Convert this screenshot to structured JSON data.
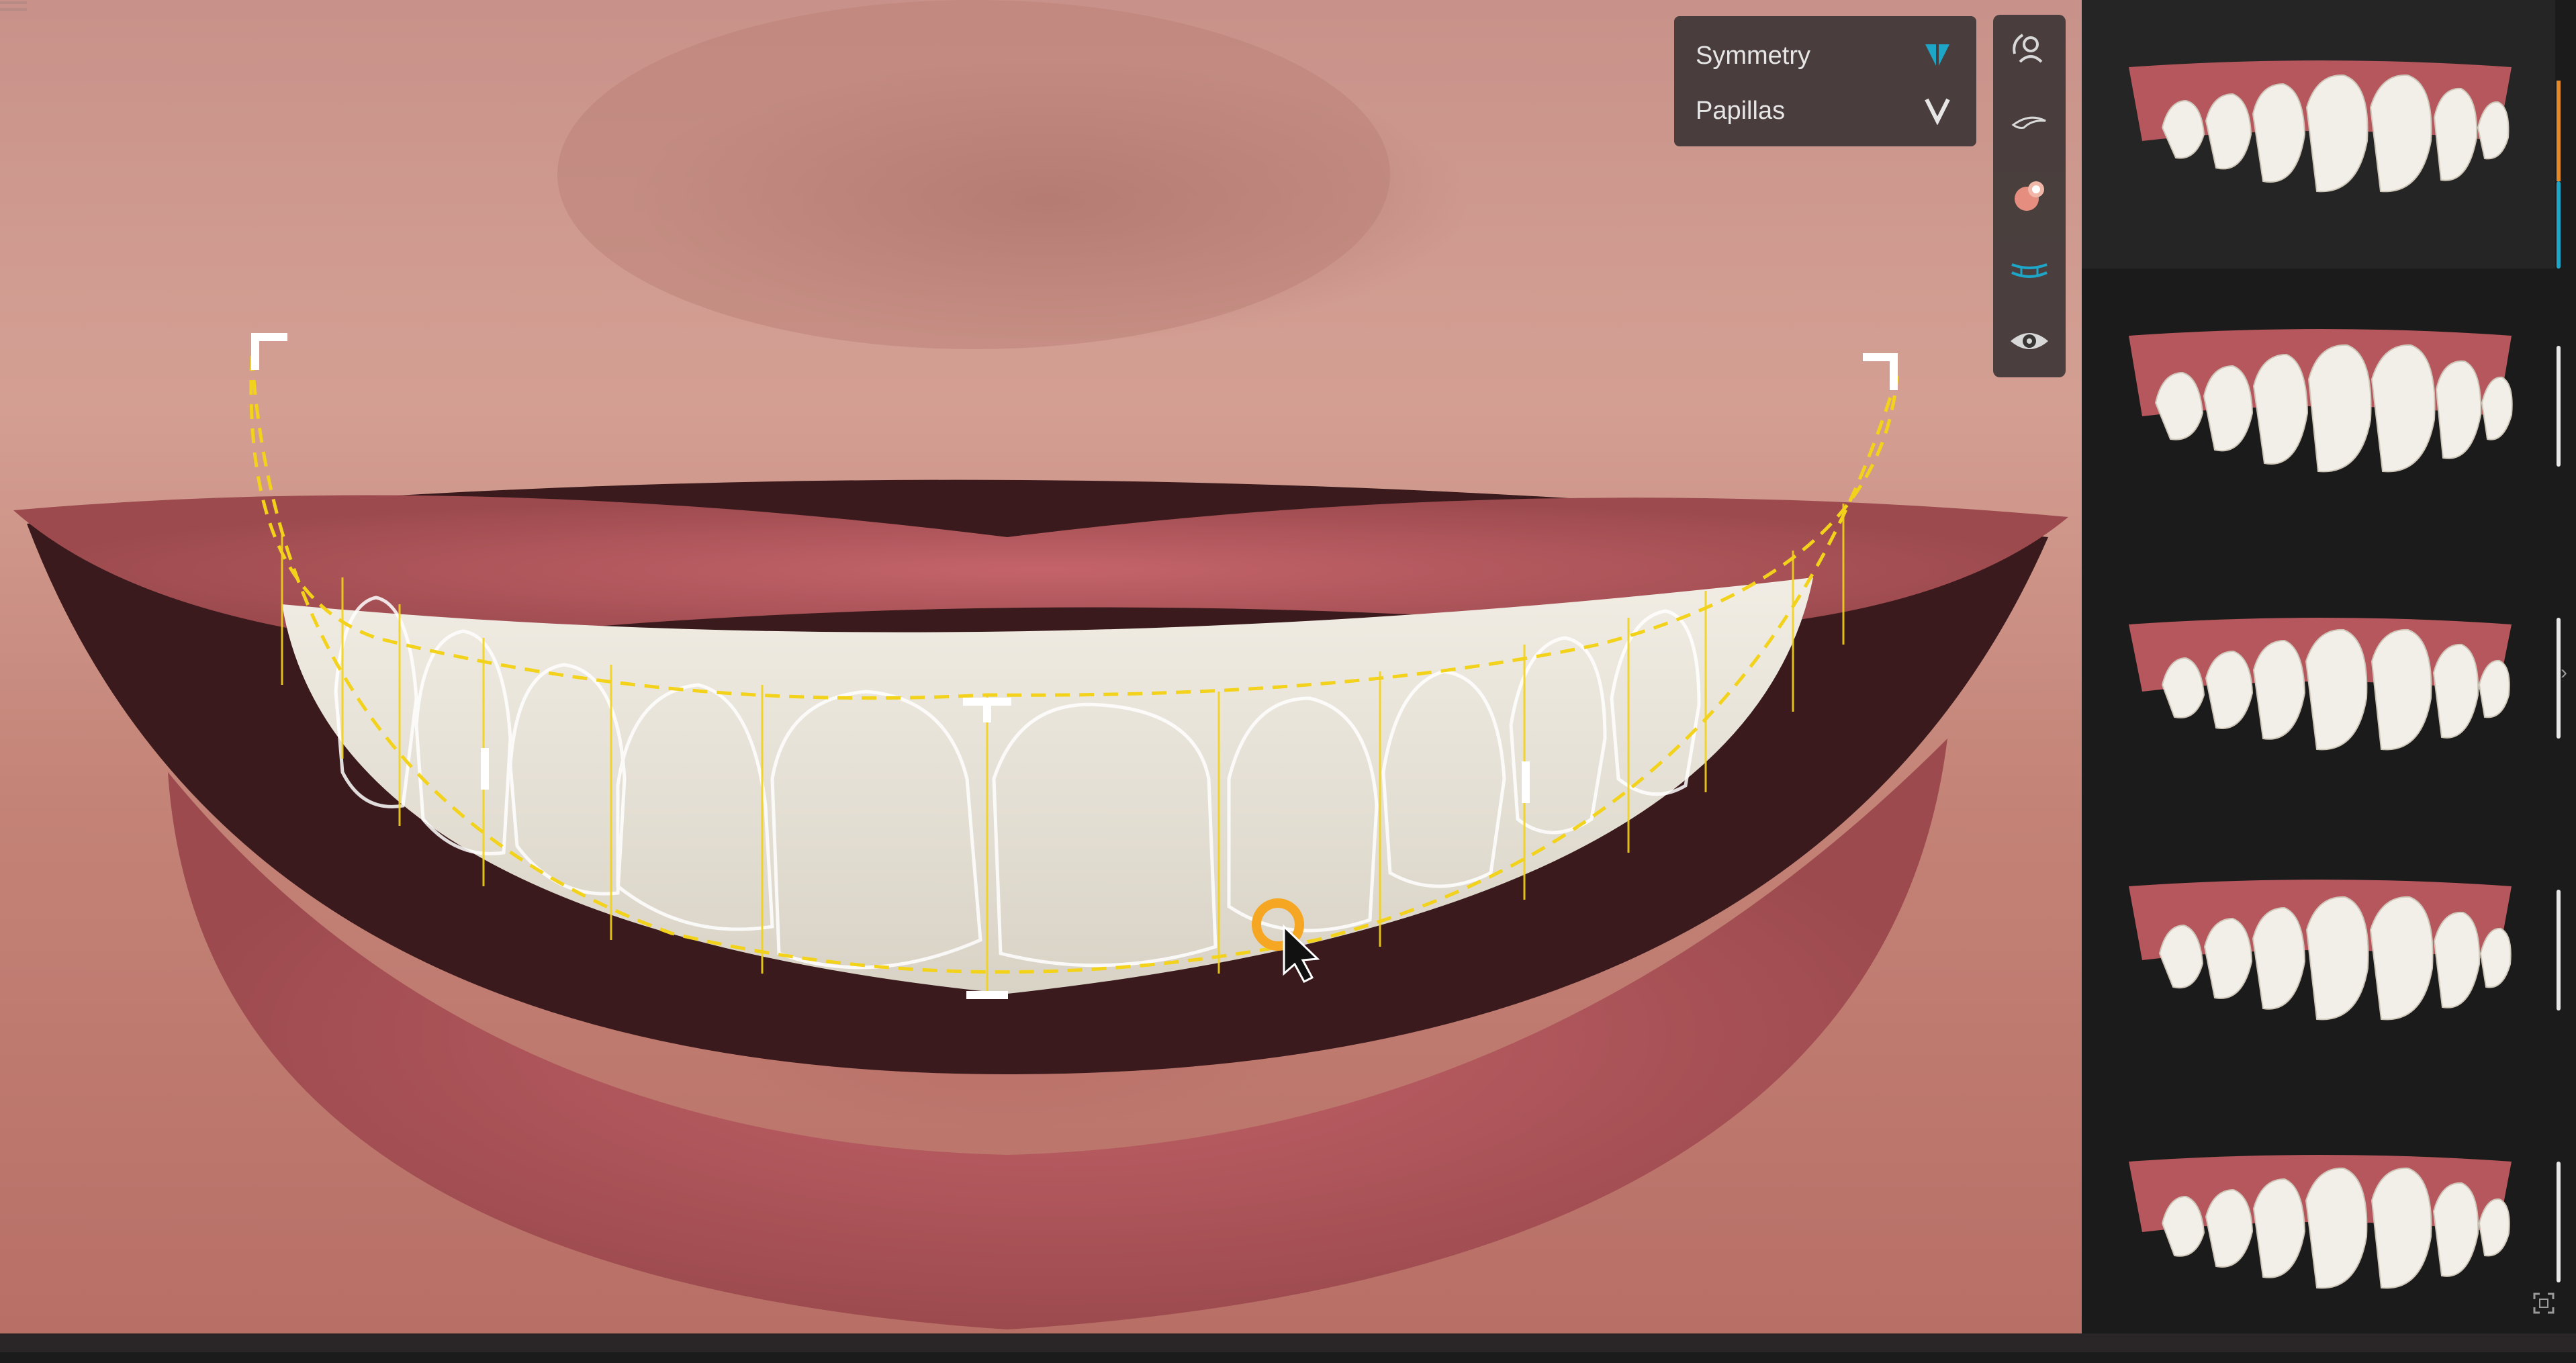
{
  "viewer": {
    "options": [
      {
        "label": "Symmetry",
        "icon": "symmetry-toggle-icon",
        "active": true
      },
      {
        "label": "Papillas",
        "icon": "chevron-down-icon",
        "active": false
      }
    ],
    "toolbar": [
      {
        "name": "face-rotate-tool",
        "icon": "face-rotate-icon"
      },
      {
        "name": "lip-line-tool",
        "icon": "lip-outline-icon"
      },
      {
        "name": "color-tool",
        "icon": "color-palette-icon"
      },
      {
        "name": "smile-arc-tool",
        "icon": "smile-arc-icon",
        "active": true
      },
      {
        "name": "visibility-tool",
        "icon": "eye-icon"
      }
    ]
  },
  "library": {
    "thumbnails": [
      {
        "name": "smile-design-1",
        "selected": true
      },
      {
        "name": "smile-design-2",
        "selected": false
      },
      {
        "name": "smile-design-3",
        "selected": false
      },
      {
        "name": "smile-design-4",
        "selected": false
      },
      {
        "name": "smile-design-5",
        "selected": false
      }
    ]
  },
  "colors": {
    "accent": "#1ea6c8",
    "guide": "#f2d21a",
    "cursor_ring": "#f5a623",
    "selection_marker": "#e08a2a"
  }
}
